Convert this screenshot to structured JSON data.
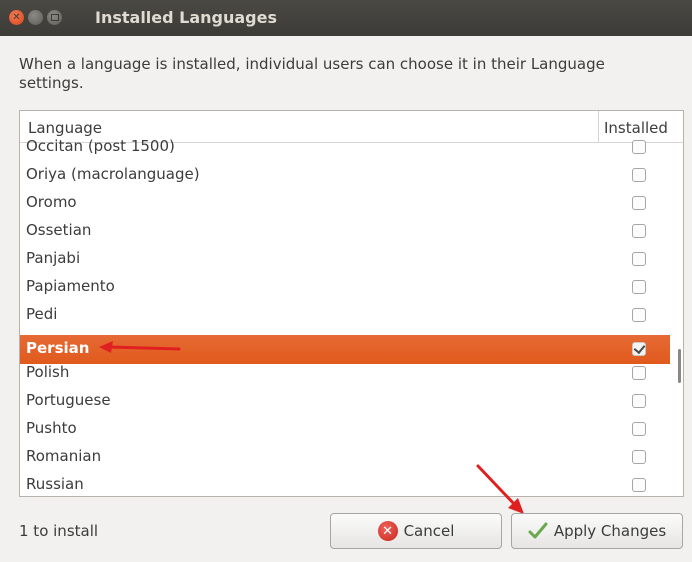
{
  "window": {
    "title": "Installed Languages"
  },
  "description": "When a language is installed, individual users can choose it in their Language settings.",
  "table": {
    "columns": [
      "Language",
      "Installed"
    ],
    "rows": [
      {
        "language": "Occitan (post 1500)",
        "installed": false,
        "selected": false
      },
      {
        "language": "Oriya (macrolanguage)",
        "installed": false,
        "selected": false
      },
      {
        "language": "Oromo",
        "installed": false,
        "selected": false
      },
      {
        "language": "Ossetian",
        "installed": false,
        "selected": false
      },
      {
        "language": "Panjabi",
        "installed": false,
        "selected": false
      },
      {
        "language": "Papiamento",
        "installed": false,
        "selected": false
      },
      {
        "language": "Pedi",
        "installed": false,
        "selected": false
      },
      {
        "language": "Persian",
        "installed": true,
        "selected": true
      },
      {
        "language": "Polish",
        "installed": false,
        "selected": false
      },
      {
        "language": "Portuguese",
        "installed": false,
        "selected": false
      },
      {
        "language": "Pushto",
        "installed": false,
        "selected": false
      },
      {
        "language": "Romanian",
        "installed": false,
        "selected": false
      },
      {
        "language": "Russian",
        "installed": false,
        "selected": false
      }
    ]
  },
  "footer": {
    "status": "1 to install",
    "cancel_label": "Cancel",
    "apply_label": "Apply Changes"
  },
  "colors": {
    "selection": "#e05a1c",
    "annotation_arrow": "#e02020",
    "titlebar": "#3c3b37"
  },
  "icons": {
    "cancel": "cancel-icon",
    "apply": "checkmark-icon"
  }
}
